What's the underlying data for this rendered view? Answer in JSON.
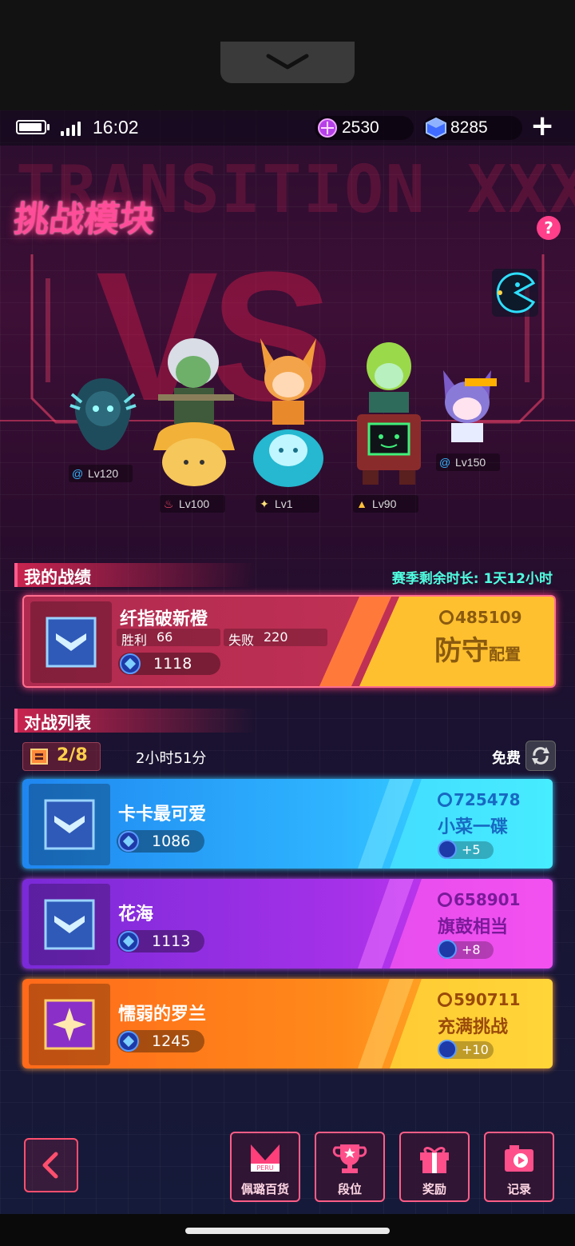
{
  "status": {
    "time": "16:02",
    "currency_a": "2530",
    "currency_b": "8285",
    "plus": "+"
  },
  "header": {
    "title": "挑战模块",
    "bg_text": "TRANSITION XXX",
    "vs": "VS"
  },
  "characters": [
    {
      "level": "Lv120",
      "element_icon": "swirl-icon"
    },
    {
      "level": "Lv100",
      "element_icon": "flame-icon"
    },
    {
      "level": "Lv1",
      "element_icon": "star-icon"
    },
    {
      "level": "Lv90",
      "element_icon": "peak-icon"
    },
    {
      "level": "Lv150",
      "element_icon": "swirl-icon"
    }
  ],
  "my_record": {
    "section_title": "我的战绩",
    "season_label": "赛季剩余时长:",
    "season_value": "1天12小时",
    "name": "纤指破新橙",
    "win_label": "胜利",
    "win_value": "66",
    "loss_label": "失败",
    "loss_value": "220",
    "trophy": "1118",
    "power": "485109",
    "defense_big": "防守",
    "defense_small": "配置"
  },
  "battle_list": {
    "section_title": "对战列表",
    "tickets": "2/8",
    "timer": "2小时51分",
    "free_label": "免费",
    "opponents": [
      {
        "name": "卡卡最可爱",
        "trophy": "1086",
        "power": "725478",
        "rank": "小菜一碟",
        "bonus": "+5"
      },
      {
        "name": "花海",
        "trophy": "1113",
        "power": "658901",
        "rank": "旗鼓相当",
        "bonus": "+8"
      },
      {
        "name": "懦弱的罗兰",
        "trophy": "1245",
        "power": "590711",
        "rank": "充满挑战",
        "bonus": "+10"
      }
    ]
  },
  "nav": {
    "shop": "佩璐百货",
    "shop_logo": "PERU",
    "rank": "段位",
    "reward": "奖励",
    "record": "记录"
  },
  "colors": {
    "accent": "#ff3f7a",
    "cyan": "#4fffe0",
    "blue_card": "#1e9bff",
    "purple_card": "#a431e8",
    "orange_card": "#ff8a1a",
    "red_card": "#c82c55"
  }
}
